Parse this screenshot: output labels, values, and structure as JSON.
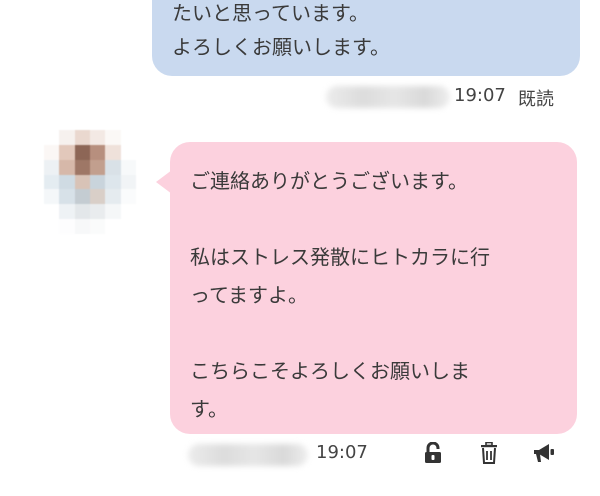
{
  "sent_message": {
    "lines": [
      "たいと思っています。",
      "よろしくお願いします。"
    ],
    "time": "19:07",
    "read_status": "既読",
    "bubble_color": "#c9d9ef"
  },
  "received_message": {
    "text": "ご連絡ありがとうございます。\n\n私はストレス発散にヒトカラに行\nってますよ。\n\nこちらこそよろしくお願いしま\nす。",
    "time": "19:07",
    "bubble_color": "#fcd1de",
    "actions": [
      {
        "icon": "unlock-icon"
      },
      {
        "icon": "trash-icon"
      },
      {
        "icon": "megaphone-icon"
      }
    ]
  }
}
